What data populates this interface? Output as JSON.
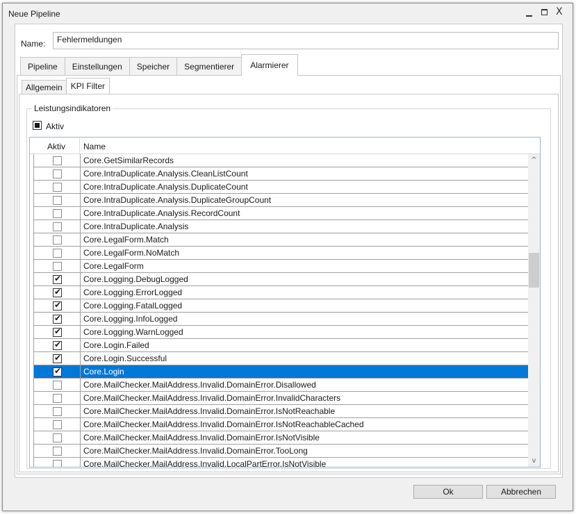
{
  "window": {
    "title": "Neue Pipeline",
    "minimize_glyph": "",
    "close_glyph": "X"
  },
  "form": {
    "name_label": "Name:",
    "name_value": "Fehlermeldungen"
  },
  "tabs": [
    {
      "label": "Pipeline",
      "active": false
    },
    {
      "label": "Einstellungen",
      "active": false
    },
    {
      "label": "Speicher",
      "active": false
    },
    {
      "label": "Segmentierer",
      "active": false
    },
    {
      "label": "Alarmierer",
      "active": true
    }
  ],
  "subtabs": [
    {
      "label": "Allgemein",
      "active": false
    },
    {
      "label": "KPI Filter",
      "active": true
    }
  ],
  "group": {
    "legend": "Leistungsindikatoren",
    "aktiv_label": "Aktiv",
    "aktiv_state": "indeterminate"
  },
  "grid": {
    "columns": {
      "aktiv": "Aktiv",
      "name": "Name"
    },
    "rows": [
      {
        "name": "Core.GetSimilarRecords",
        "checked": false,
        "selected": false
      },
      {
        "name": "Core.IntraDuplicate.Analysis.CleanListCount",
        "checked": false,
        "selected": false
      },
      {
        "name": "Core.IntraDuplicate.Analysis.DuplicateCount",
        "checked": false,
        "selected": false
      },
      {
        "name": "Core.IntraDuplicate.Analysis.DuplicateGroupCount",
        "checked": false,
        "selected": false
      },
      {
        "name": "Core.IntraDuplicate.Analysis.RecordCount",
        "checked": false,
        "selected": false
      },
      {
        "name": "Core.IntraDuplicate.Analysis",
        "checked": false,
        "selected": false
      },
      {
        "name": "Core.LegalForm.Match",
        "checked": false,
        "selected": false
      },
      {
        "name": "Core.LegalForm.NoMatch",
        "checked": false,
        "selected": false
      },
      {
        "name": "Core.LegalForm",
        "checked": false,
        "selected": false
      },
      {
        "name": "Core.Logging.DebugLogged",
        "checked": true,
        "selected": false
      },
      {
        "name": "Core.Logging.ErrorLogged",
        "checked": true,
        "selected": false
      },
      {
        "name": "Core.Logging.FatalLogged",
        "checked": true,
        "selected": false
      },
      {
        "name": "Core.Logging.InfoLogged",
        "checked": true,
        "selected": false
      },
      {
        "name": "Core.Logging.WarnLogged",
        "checked": true,
        "selected": false
      },
      {
        "name": "Core.Login.Failed",
        "checked": true,
        "selected": false
      },
      {
        "name": "Core.Login.Successful",
        "checked": true,
        "selected": false
      },
      {
        "name": "Core.Login",
        "checked": true,
        "selected": true
      },
      {
        "name": "Core.MailChecker.MailAddress.Invalid.DomainError.Disallowed",
        "checked": false,
        "selected": false
      },
      {
        "name": "Core.MailChecker.MailAddress.Invalid.DomainError.InvalidCharacters",
        "checked": false,
        "selected": false
      },
      {
        "name": "Core.MailChecker.MailAddress.Invalid.DomainError.IsNotReachable",
        "checked": false,
        "selected": false
      },
      {
        "name": "Core.MailChecker.MailAddress.Invalid.DomainError.IsNotReachableCached",
        "checked": false,
        "selected": false
      },
      {
        "name": "Core.MailChecker.MailAddress.Invalid.DomainError.IsNotVisible",
        "checked": false,
        "selected": false
      },
      {
        "name": "Core.MailChecker.MailAddress.Invalid.DomainError.TooLong",
        "checked": false,
        "selected": false
      },
      {
        "name": "Core.MailChecker.MailAddress.Invalid.LocalPartError.IsNotVisible",
        "checked": false,
        "selected": false
      }
    ]
  },
  "buttons": {
    "ok": "Ok",
    "cancel": "Abbrechen"
  },
  "icons": {
    "check": "✔",
    "scroll_up": "^",
    "scroll_down": "v"
  },
  "colors": {
    "selection": "#0078d7",
    "window_bg": "#f0f0f0"
  }
}
